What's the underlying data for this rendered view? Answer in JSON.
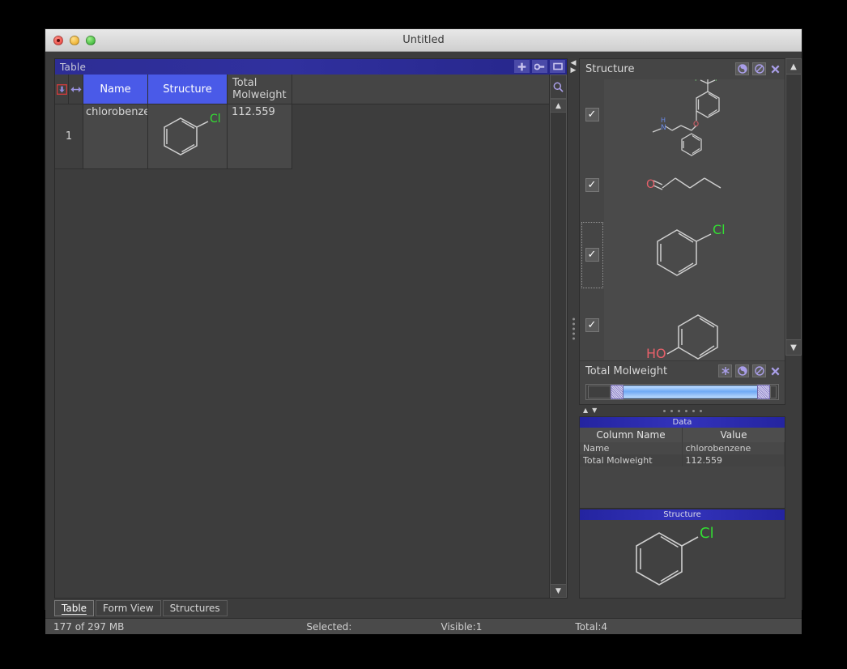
{
  "window": {
    "title": "Untitled",
    "traffic": {
      "close": "close-button",
      "minimize": "minimize-button",
      "maximize": "maximize-button"
    }
  },
  "table_panel": {
    "title": "Table",
    "toolbar": [
      {
        "name": "add-column-button",
        "icon": "plus-icon"
      },
      {
        "name": "connect-button",
        "icon": "wrench-icon"
      },
      {
        "name": "maximize-panel-button",
        "icon": "window-icon"
      }
    ],
    "row_gadget_icons": [
      {
        "name": "insert-row-icon",
        "icon": "down-arrow-into-box-icon"
      },
      {
        "name": "resize-columns-icon",
        "icon": "left-right-arrow-icon"
      }
    ],
    "columns": [
      {
        "label": "Name",
        "selected": true
      },
      {
        "label": "Structure",
        "selected": true
      },
      {
        "label": "Total\nMolweight",
        "selected": false
      }
    ],
    "column_mw_line1": "Total",
    "column_mw_line2": "Molweight",
    "rows": [
      {
        "number": "1",
        "name": "chlorobenzen",
        "structure": "chlorobenzene-structure",
        "molweight": "112.559"
      }
    ],
    "search_icon": "search-icon",
    "scroll_up": "▲",
    "scroll_down": "▼"
  },
  "splitter": {
    "collapse_left": "◀",
    "collapse_right": "▶",
    "grip": "grip-dots"
  },
  "detail_panel": {
    "structure_group": {
      "title": "Structure",
      "buttons": [
        {
          "name": "contrast-toggle-button",
          "icon": "contrast-circle-icon"
        },
        {
          "name": "disable-filter-button",
          "icon": "prohibited-circle-icon"
        },
        {
          "name": "close-group-button",
          "icon": "close-icon"
        }
      ],
      "items": [
        {
          "checked": true,
          "check_glyph": "✓",
          "molecule": "fluoxetine",
          "focused": false
        },
        {
          "checked": true,
          "check_glyph": "✓",
          "molecule": "butanal",
          "focused": false
        },
        {
          "checked": true,
          "check_glyph": "✓",
          "molecule": "chlorobenzene",
          "focused": true
        },
        {
          "checked": true,
          "check_glyph": "✓",
          "molecule": "phenol",
          "focused": false
        }
      ]
    },
    "molweight_group": {
      "title": "Total Molweight",
      "buttons": [
        {
          "name": "snowflake-button",
          "icon": "asterisk-icon"
        },
        {
          "name": "contrast-toggle-button",
          "icon": "contrast-circle-icon"
        },
        {
          "name": "disable-filter-button",
          "icon": "prohibited-circle-icon"
        },
        {
          "name": "close-group-button",
          "icon": "close-icon"
        }
      ],
      "slider": {
        "low_handle": "range-low-handle",
        "high_handle": "range-high-handle"
      }
    },
    "form_nav": {
      "up": "▲",
      "down": "▼"
    },
    "data_section": {
      "title": "Data",
      "headers": [
        "Column Name",
        "Value"
      ],
      "rows": [
        {
          "column": "Name",
          "value": "chlorobenzene"
        },
        {
          "column": "Total Molweight",
          "value": "112.559"
        }
      ]
    },
    "structure_section": {
      "title": "Structure",
      "molecule": "chlorobenzene"
    },
    "scrollbar": {
      "up": "▲",
      "down": "▼"
    }
  },
  "tabs": [
    {
      "label": "Table",
      "active": true
    },
    {
      "label": "Form View",
      "active": false
    },
    {
      "label": "Structures",
      "active": false
    }
  ],
  "statusbar": {
    "memory": "177 of 297 MB",
    "selected": "Selected:",
    "visible": "Visible:1",
    "total": "Total:4"
  },
  "colors": {
    "accent_blue": "#4a5ae8",
    "title_blue": "#2d2d95",
    "chlorine_green": "#33dd33",
    "oxygen_red": "#e8606a",
    "nitrogen_blue": "#6b8ae8",
    "fluorine_green": "#7ac87a",
    "bond_grey": "#cfcfcf"
  }
}
